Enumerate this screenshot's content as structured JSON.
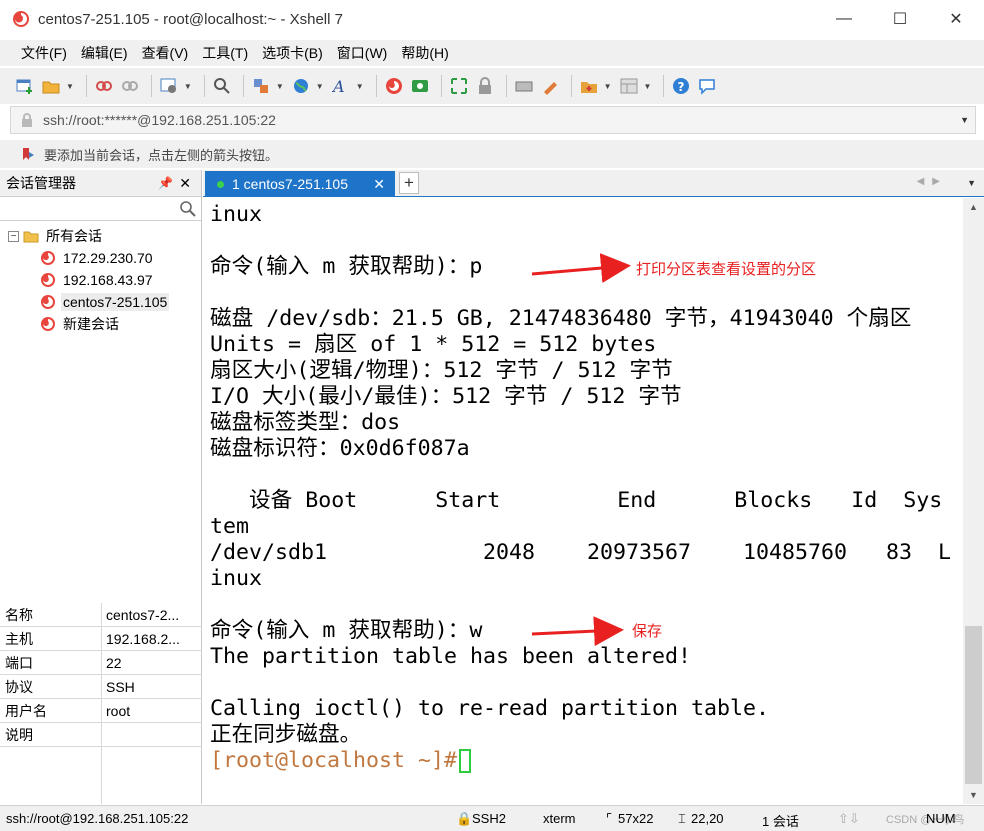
{
  "window": {
    "title": "centos7-251.105 - root@localhost:~ - Xshell 7",
    "minimize": "—",
    "maximize": "☐",
    "close": "✕"
  },
  "menu": [
    "文件(F)",
    "编辑(E)",
    "查看(V)",
    "工具(T)",
    "选项卡(B)",
    "窗口(W)",
    "帮助(H)"
  ],
  "address": {
    "value": "ssh://root:******@192.168.251.105:22"
  },
  "hint": {
    "text": "要添加当前会话，点击左侧的箭头按钮。"
  },
  "session_manager": {
    "title": "会话管理器",
    "pin": "ᵖ",
    "close": "✕",
    "root_label": "所有会话",
    "root_expander": "−",
    "items": [
      {
        "label": "172.29.230.70"
      },
      {
        "label": "192.168.43.97"
      },
      {
        "label": "centos7-251.105",
        "selected": true
      },
      {
        "label": "新建会话"
      }
    ]
  },
  "properties": [
    {
      "key": "名称",
      "value": "centos7-2..."
    },
    {
      "key": "主机",
      "value": "192.168.2..."
    },
    {
      "key": "端口",
      "value": "22"
    },
    {
      "key": "协议",
      "value": "SSH"
    },
    {
      "key": "用户名",
      "value": "root"
    },
    {
      "key": "说明",
      "value": ""
    }
  ],
  "tab": {
    "label": "1 centos7-251.105",
    "close": "✕",
    "add": "+"
  },
  "terminal": {
    "lines": [
      "inux",
      "",
      "命令(输入 m 获取帮助)：p",
      "",
      "磁盘 /dev/sdb：21.5 GB, 21474836480 字节，41943040 个扇区",
      "Units = 扇区 of 1 * 512 = 512 bytes",
      "扇区大小(逻辑/物理)：512 字节 / 512 字节",
      "I/O 大小(最小/最佳)：512 字节 / 512 字节",
      "磁盘标签类型：dos",
      "磁盘标识符：0x0d6f087a",
      "",
      "   设备 Boot      Start         End      Blocks   Id  Sys",
      "tem",
      "/dev/sdb1            2048    20973567    10485760   83  L",
      "inux",
      "",
      "命令(输入 m 获取帮助)：w",
      "The partition table has been altered!",
      "",
      "Calling ioctl() to re-read partition table.",
      "正在同步磁盘。"
    ],
    "prompt": "[root@localhost ~]#"
  },
  "annotations": {
    "print_label": "打印分区表查看设置的分区",
    "save_label": "保存",
    "color": "#e8201f"
  },
  "status": {
    "connection": "ssh://root@192.168.251.105:22",
    "protocol": "SSH2",
    "terminal_type": "xterm",
    "size": "57x22",
    "cursor_pos": "22,20",
    "sessions": "1 会话",
    "watermark": "CSDN @一小鸟",
    "numlock": "NUM"
  }
}
